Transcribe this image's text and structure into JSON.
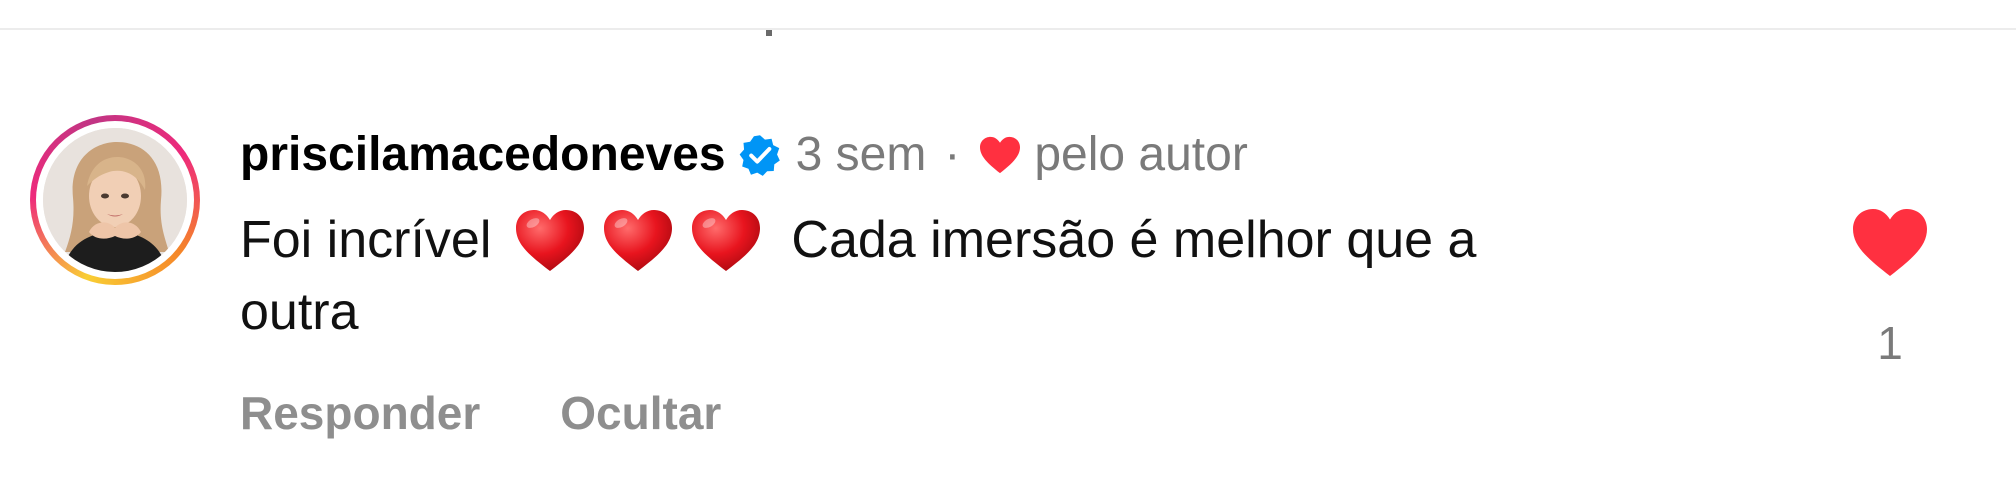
{
  "comment": {
    "username": "priscilamacedoneves",
    "verified": true,
    "time": "3 sem",
    "separator": "·",
    "liked_by_author_label": "pelo autor",
    "text_line1_start": "Foi incrível",
    "text_line1_end": "Cada imersão é melhor que a",
    "text_line2": "outra",
    "emoji_icons": [
      "heart-emoji",
      "heart-emoji",
      "heart-emoji"
    ],
    "like_count": "1",
    "actions": {
      "reply": "Responder",
      "hide": "Ocultar"
    }
  },
  "icons": {
    "verified": "verified-badge-icon",
    "author_heart": "heart-icon",
    "like": "heart-icon"
  },
  "colors": {
    "heart_red": "#ff3040",
    "verified_blue": "#0095f6",
    "muted_text": "#7a7a7a",
    "action_text": "#8e8e8e"
  }
}
